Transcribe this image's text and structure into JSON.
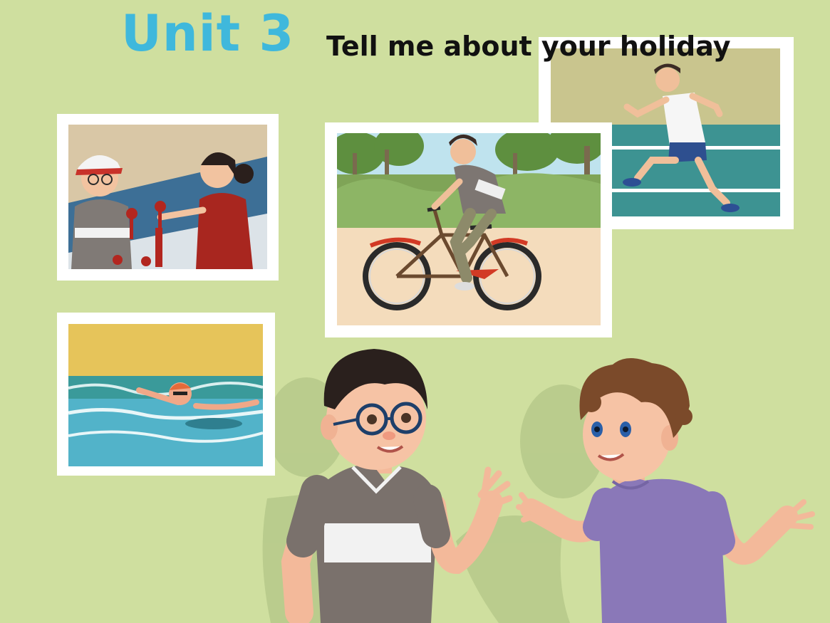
{
  "header": {
    "unit_label": "Unit 3",
    "subtitle": "Tell me about your holiday"
  },
  "colors": {
    "background": "#cfdf9f",
    "unit_title": "#3fb8dc",
    "subtitle": "#111111",
    "photo_frame": "#ffffff",
    "shadow": "#b4c688",
    "boy_left_shirt": "#7a716c",
    "boy_right_shirt": "#8a78b8"
  },
  "photos": [
    {
      "name": "photo-shopping",
      "scene": "boy buying red knots from a woman in a qipao"
    },
    {
      "name": "photo-cycling",
      "scene": "boy riding a bicycle"
    },
    {
      "name": "photo-running",
      "scene": "boy running on a track"
    },
    {
      "name": "photo-swimming",
      "scene": "boy swimming in the sea"
    }
  ],
  "characters": [
    {
      "name": "boy-left",
      "scene": "boy with glasses talking"
    },
    {
      "name": "boy-right",
      "scene": "boy in purple shirt talking"
    }
  ]
}
